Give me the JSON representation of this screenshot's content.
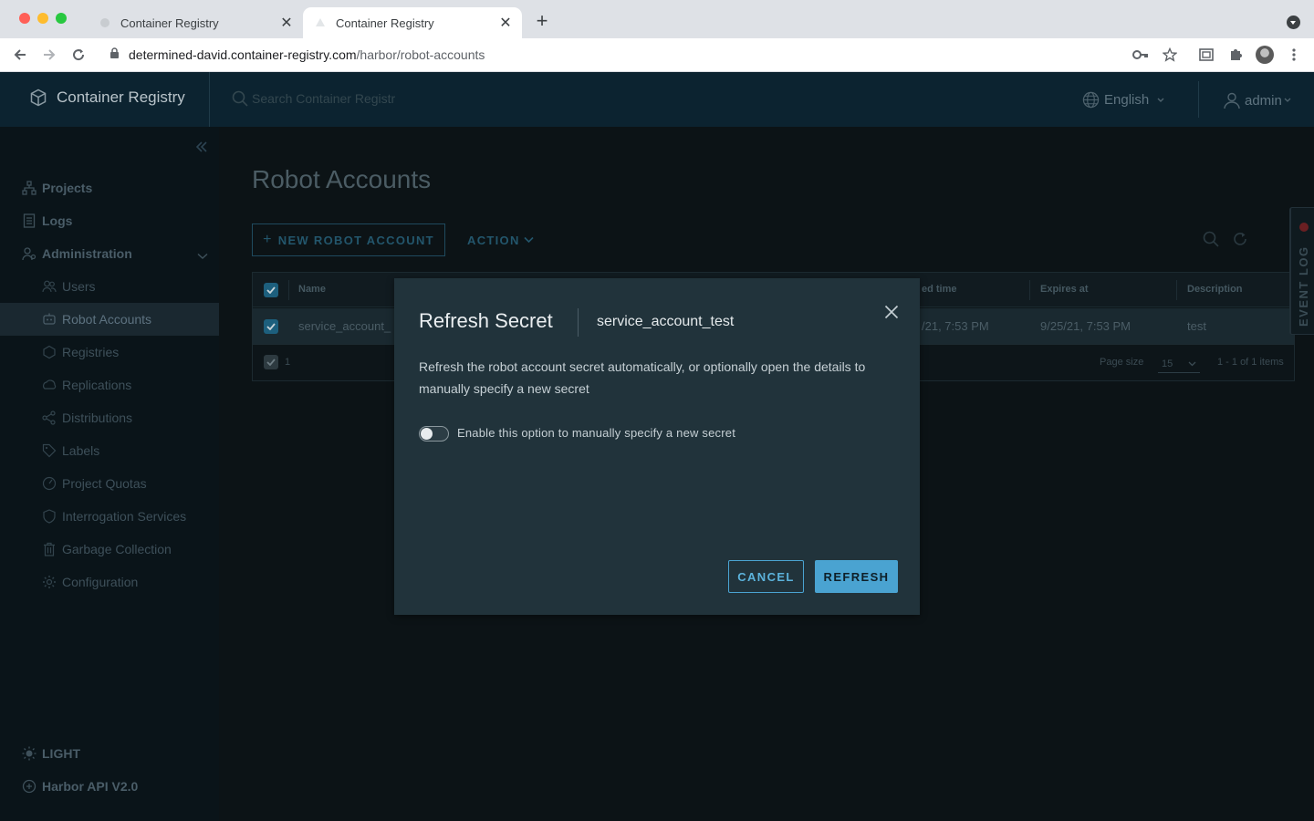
{
  "browser": {
    "tabs": [
      {
        "title": "Container Registry",
        "active": false
      },
      {
        "title": "Container Registry",
        "active": true
      }
    ],
    "url_host": "determined-david.container-registry.com",
    "url_path": "/harbor/robot-accounts"
  },
  "header": {
    "brand": "Container Registry",
    "search_placeholder": "Search Container Registr",
    "language": "English",
    "user": "admin"
  },
  "sidebar": {
    "items": [
      {
        "label": "Projects",
        "icon": "projects-icon"
      },
      {
        "label": "Logs",
        "icon": "logs-icon"
      },
      {
        "label": "Administration",
        "icon": "administration-icon"
      }
    ],
    "admin_items": [
      {
        "label": "Users",
        "icon": "users-icon"
      },
      {
        "label": "Robot Accounts",
        "icon": "robot-icon"
      },
      {
        "label": "Registries",
        "icon": "registries-icon"
      },
      {
        "label": "Replications",
        "icon": "replications-icon"
      },
      {
        "label": "Distributions",
        "icon": "distributions-icon"
      },
      {
        "label": "Labels",
        "icon": "labels-icon"
      },
      {
        "label": "Project Quotas",
        "icon": "quotas-icon"
      },
      {
        "label": "Interrogation Services",
        "icon": "shield-icon"
      },
      {
        "label": "Garbage Collection",
        "icon": "trash-icon"
      },
      {
        "label": "Configuration",
        "icon": "gear-icon"
      }
    ],
    "theme_toggle": "LIGHT",
    "api_link": "Harbor API V2.0"
  },
  "main": {
    "title": "Robot Accounts",
    "new_button": "NEW ROBOT ACCOUNT",
    "action_button": "ACTION",
    "columns": [
      "Name",
      "ed time",
      "Expires at",
      "Description"
    ],
    "rows": [
      {
        "name": "service_account_",
        "time": "/21, 7:53 PM",
        "expires": "9/25/21, 7:53 PM",
        "description": "test"
      }
    ],
    "footer_selected": "1",
    "page_size_label": "Page size",
    "page_size": "15",
    "items_count": "1 - 1 of 1 items",
    "event_log": "EVENT LOG"
  },
  "modal": {
    "title": "Refresh Secret",
    "subtitle": "service_account_test",
    "description": "Refresh the robot account secret automatically, or optionally open the details to manually specify a new secret",
    "toggle_label": "Enable this option to manually specify a new secret",
    "toggle_on": false,
    "cancel": "CANCEL",
    "refresh": "REFRESH"
  },
  "colors": {
    "accent": "#4aa3d1",
    "modal_bg": "#21333b",
    "header_bg": "#0c2330"
  }
}
